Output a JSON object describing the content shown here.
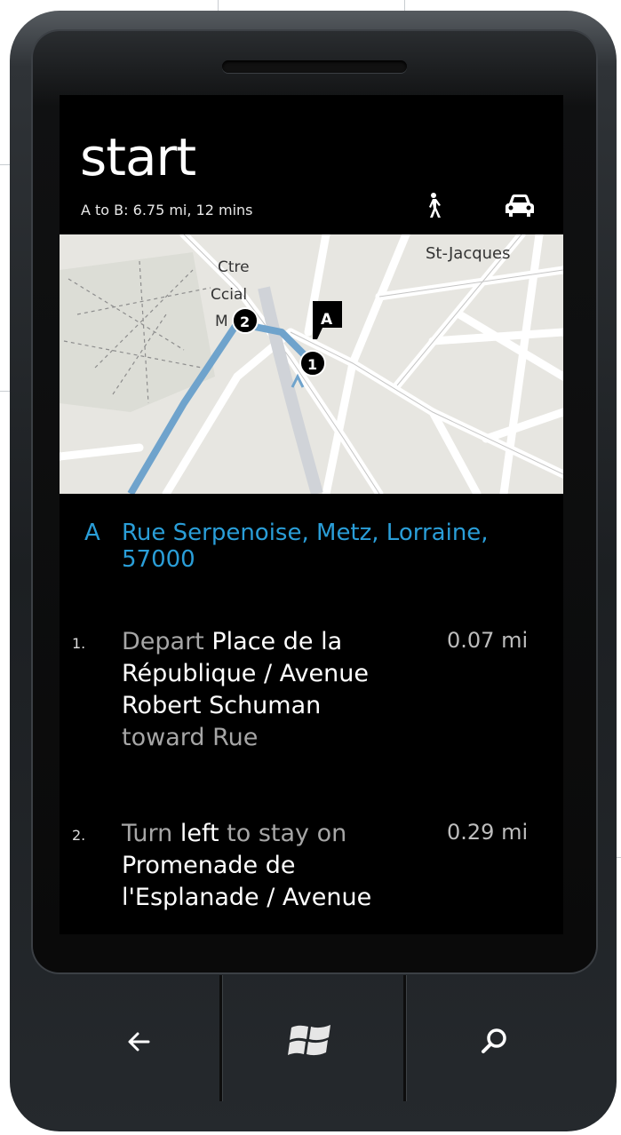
{
  "app": {
    "title": "start",
    "summary": "A to B: 6.75 mi, 12 mins"
  },
  "modes": {
    "walk": "walk-icon",
    "drive": "car-icon"
  },
  "map": {
    "labels": {
      "st_jacques": "St-Jacques",
      "ctre_line1": "Ctre",
      "ctre_line2": "Ccial",
      "ctre_line3": "M"
    },
    "pins": {
      "pin_a": "A",
      "pin_1": "1",
      "pin_2": "2"
    },
    "route_color": "#6fa3cc"
  },
  "destination": {
    "letter": "A",
    "address": "Rue Serpenoise, Metz, Lorraine, 57000",
    "color": "#2a9ed8"
  },
  "steps": [
    {
      "number": "1.",
      "action": "Depart",
      "street": "Place de la République / Avenue Robert Schuman",
      "suffix": "toward Rue",
      "distance": "0.07 mi"
    },
    {
      "number": "2.",
      "action_pre": "Turn",
      "action_bold": "left",
      "action_post": "to stay on",
      "street": "Promenade de l'Esplanade / Avenue",
      "distance": "0.29 mi"
    }
  ],
  "hardware": {
    "back": "back-arrow-icon",
    "start": "windows-logo-icon",
    "search": "search-icon"
  }
}
